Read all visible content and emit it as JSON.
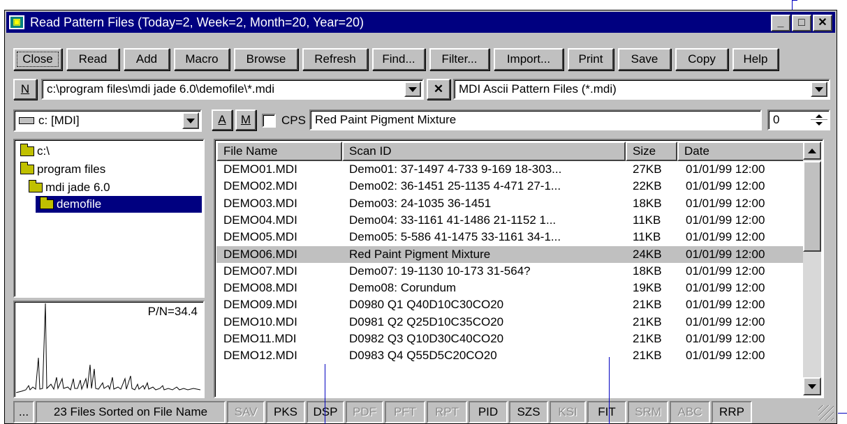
{
  "window": {
    "title": "Read Pattern Files (Today=2, Week=2, Month=20, Year=20)"
  },
  "toolbar": [
    {
      "label": "Close"
    },
    {
      "label": "Read"
    },
    {
      "label": "Add"
    },
    {
      "label": "Macro"
    },
    {
      "label": "Browse"
    },
    {
      "label": "Refresh"
    },
    {
      "label": "Find..."
    },
    {
      "label": "Filter..."
    },
    {
      "label": "Import..."
    },
    {
      "label": "Print"
    },
    {
      "label": "Save"
    },
    {
      "label": "Copy"
    },
    {
      "label": "Help"
    }
  ],
  "path": {
    "n_label": "N",
    "value": "c:\\program files\\mdi jade 6.0\\demofile\\*.mdi",
    "filter": "MDI Ascii Pattern Files (*.mdi)"
  },
  "drive": {
    "value": "c: [MDI]"
  },
  "options": {
    "a_label": "A",
    "m_label": "M",
    "cps_label": "CPS",
    "scan_value": "Red Paint Pigment Mixture",
    "number": "0"
  },
  "tree": [
    {
      "label": "c:\\"
    },
    {
      "label": "program files"
    },
    {
      "label": "mdi jade 6.0"
    },
    {
      "label": "demofile"
    }
  ],
  "preview": {
    "pn_label": "P/N=34.4"
  },
  "columns": [
    "File Name",
    "Scan ID",
    "Size",
    "Date"
  ],
  "files": [
    [
      "DEMO01.MDI",
      "Demo01: 37-1497 4-733 9-169 18-303...",
      "27KB",
      "01/01/99 12:00"
    ],
    [
      "DEMO02.MDI",
      "Demo02: 36-1451 25-1135 4-471 27-1...",
      "22KB",
      "01/01/99 12:00"
    ],
    [
      "DEMO03.MDI",
      "Demo03: 24-1035 36-1451",
      "18KB",
      "01/01/99 12:00"
    ],
    [
      "DEMO04.MDI",
      "Demo04: 33-1161 41-1486 21-1152 1...",
      "11KB",
      "01/01/99 12:00"
    ],
    [
      "DEMO05.MDI",
      "Demo05: 5-586 41-1475 33-1161 34-1...",
      "11KB",
      "01/01/99 12:00"
    ],
    [
      "DEMO06.MDI",
      "Red Paint Pigment Mixture",
      "24KB",
      "01/01/99 12:00"
    ],
    [
      "DEMO07.MDI",
      "Demo07: 19-1130 10-173 31-564?",
      "18KB",
      "01/01/99 12:00"
    ],
    [
      "DEMO08.MDI",
      "Demo08: Corundum",
      "19KB",
      "01/01/99 12:00"
    ],
    [
      "DEMO09.MDI",
      "D0980 Q1 Q40D10C30CO20",
      "21KB",
      "01/01/99 12:00"
    ],
    [
      "DEMO10.MDI",
      "D0981 Q2 Q25D10C35CO20",
      "21KB",
      "01/01/99 12:00"
    ],
    [
      "DEMO11.MDI",
      "D0982 Q3 Q10D30C40CO20",
      "21KB",
      "01/01/99 12:00"
    ],
    [
      "DEMO12.MDI",
      "D0983 Q4 Q55D5C20CO20",
      "21KB",
      "01/01/99 12:00"
    ]
  ],
  "status": [
    {
      "label": "...",
      "on": true
    },
    {
      "label": "23 Files Sorted on File Name",
      "on": true
    },
    {
      "label": "SAV",
      "on": false
    },
    {
      "label": "PKS",
      "on": true
    },
    {
      "label": "DSP",
      "on": true
    },
    {
      "label": "PDF",
      "on": false
    },
    {
      "label": "PFT",
      "on": false
    },
    {
      "label": "RPT",
      "on": false
    },
    {
      "label": "PID",
      "on": true
    },
    {
      "label": "SZS",
      "on": true
    },
    {
      "label": "KSI",
      "on": false
    },
    {
      "label": "FIT",
      "on": true
    },
    {
      "label": "SRM",
      "on": false
    },
    {
      "label": "ABC",
      "on": false
    },
    {
      "label": "RRP",
      "on": true
    }
  ]
}
